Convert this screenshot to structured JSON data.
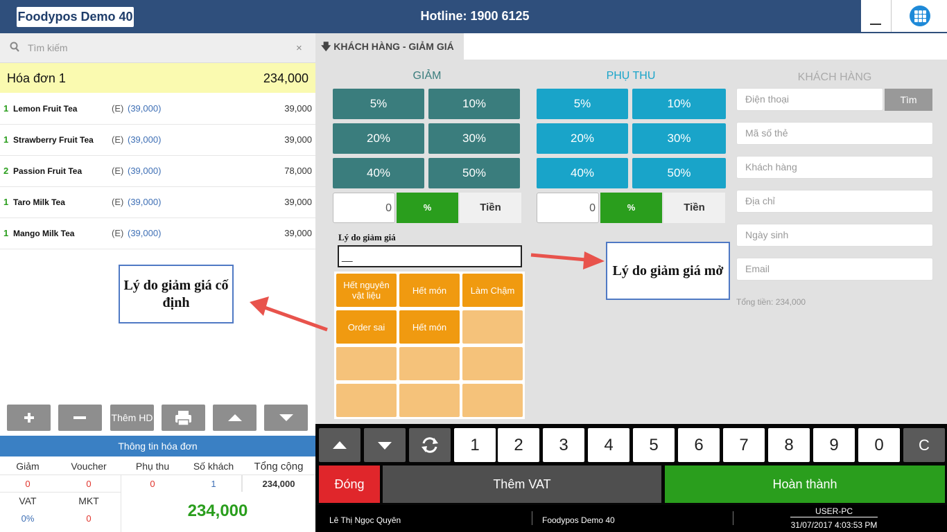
{
  "header": {
    "brand": "Foodypos Demo 40",
    "hotline": "Hotline: 1900 6125"
  },
  "search": {
    "placeholder": "Tìm kiếm",
    "clear": "×"
  },
  "invoice": {
    "title": "Hóa đơn 1",
    "total": "234,000"
  },
  "items": [
    {
      "qty": "1",
      "name": "Lemon Fruit Tea",
      "tag": "(E)",
      "price": "(39,000)",
      "total": "39,000"
    },
    {
      "qty": "1",
      "name": "Strawberry Fruit Tea",
      "tag": "(E)",
      "price": "(39,000)",
      "total": "39,000"
    },
    {
      "qty": "2",
      "name": "Passion Fruit Tea",
      "tag": "(E)",
      "price": "(39,000)",
      "total": "78,000"
    },
    {
      "qty": "1",
      "name": "Taro Milk Tea",
      "tag": "(E)",
      "price": "(39,000)",
      "total": "39,000"
    },
    {
      "qty": "1",
      "name": "Mango Milk Tea",
      "tag": "(E)",
      "price": "(39,000)",
      "total": "39,000"
    }
  ],
  "actions": {
    "add_invoice": "Thêm HD"
  },
  "info": {
    "title": "Thông tin hóa đơn",
    "headers": [
      "Giảm",
      "Voucher",
      "Phụ thu",
      "Số khách",
      "Tổng cộng"
    ],
    "values": [
      "0",
      "0",
      "0",
      "1",
      "234,000"
    ],
    "vat_label": "VAT",
    "mkt_label": "MKT",
    "vat": "0%",
    "mkt": "0",
    "grand_total": "234,000"
  },
  "tab": {
    "label": "KHÁCH HÀNG - GIẢM GIÁ"
  },
  "discount": {
    "title": "GIẢM",
    "buttons": [
      "5%",
      "10%",
      "20%",
      "30%",
      "40%",
      "50%"
    ],
    "value": "0",
    "pct": "%",
    "money": "Tiền"
  },
  "surcharge": {
    "title": "PHỤ THU",
    "buttons": [
      "5%",
      "10%",
      "20%",
      "30%",
      "40%",
      "50%"
    ],
    "value": "0",
    "pct": "%",
    "money": "Tiền"
  },
  "reason": {
    "label": "Lý do giảm giá",
    "input_value": "__",
    "presets": [
      "Hết nguyên vật liệu",
      "Hết món",
      "Làm Chậm",
      "Order sai",
      "Hết món"
    ]
  },
  "customer": {
    "title": "KHÁCH HÀNG",
    "phone": "Điện thoại",
    "search_btn": "Tìm",
    "card": "Mã số thẻ",
    "name": "Khách hàng",
    "address": "Địa chỉ",
    "birthday": "Ngày sinh",
    "email": "Email",
    "total": "Tổng tiền: 234,000"
  },
  "annotations": {
    "fixed": "Lý do giảm giá cố định",
    "open": "Lý do giảm giá mở"
  },
  "keypad": {
    "digits": [
      "1",
      "2",
      "3",
      "4",
      "5",
      "6",
      "7",
      "8",
      "9",
      "0"
    ],
    "clear": "C"
  },
  "bottom": {
    "close": "Đóng",
    "vat": "Thêm VAT",
    "done": "Hoàn thành"
  },
  "footer": {
    "user": "Lê Thị Ngọc Quyên",
    "store": "Foodypos Demo 40",
    "pc": "USER-PC",
    "datetime": "31/07/2017 4:03:53 PM"
  },
  "colors": {
    "header": "#2f4f7c",
    "discount": "#3a7d7d",
    "surcharge": "#19a4c9",
    "preset": "#f09a10",
    "accent_green": "#2a9e1d",
    "danger": "#e0262b"
  }
}
